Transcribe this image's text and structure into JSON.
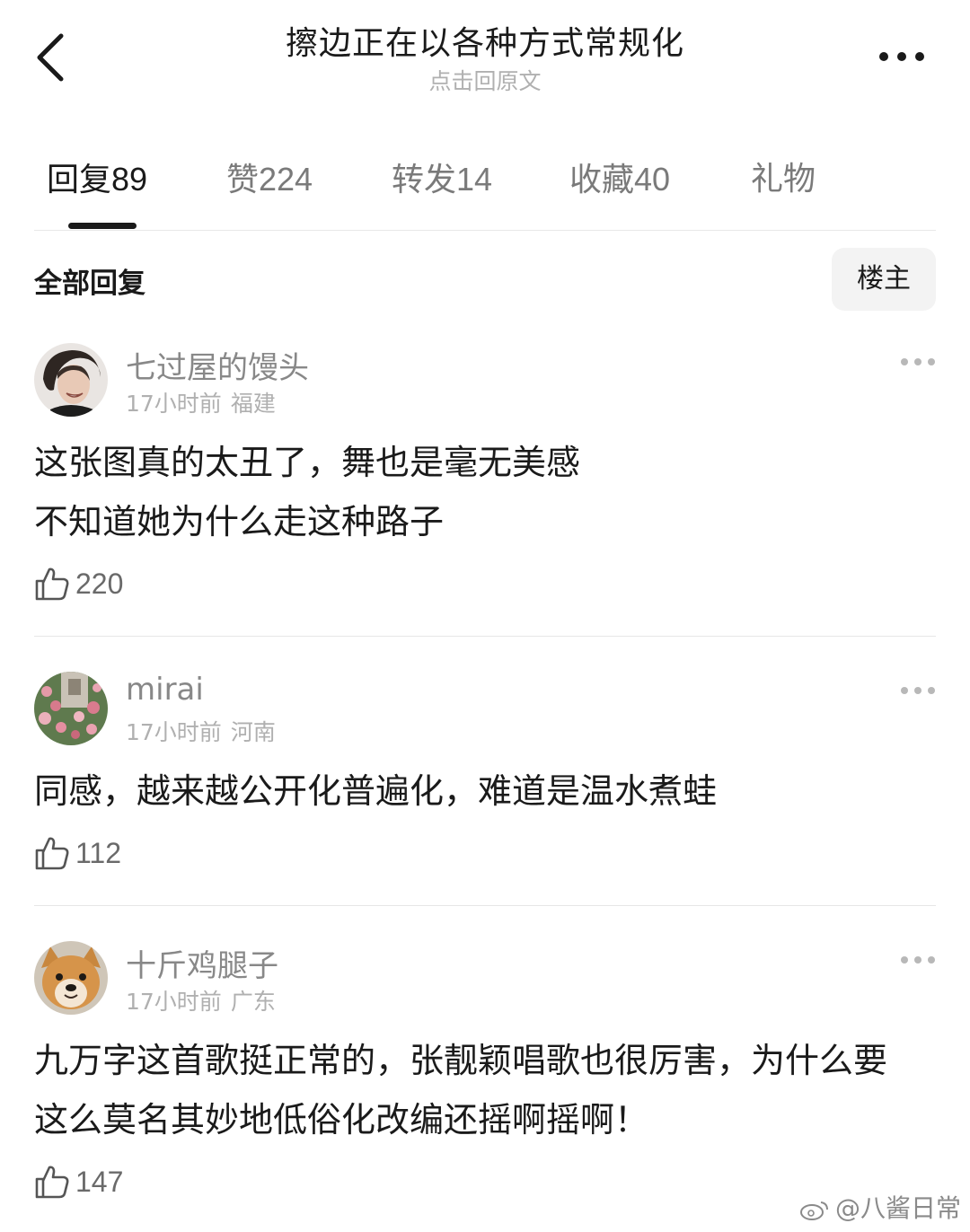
{
  "header": {
    "back_icon": "chevron-left-icon",
    "title": "擦边正在以各种方式常规化",
    "subtitle": "点击回原文",
    "more_icon": "more-horizontal-icon"
  },
  "tabs": [
    {
      "label": "回复",
      "count": "89",
      "active": true
    },
    {
      "label": "赞",
      "count": "224",
      "active": false
    },
    {
      "label": "转发",
      "count": "14",
      "active": false
    },
    {
      "label": "收藏",
      "count": "40",
      "active": false
    },
    {
      "label": "礼物",
      "count": "",
      "active": false
    }
  ],
  "filter": {
    "label": "全部回复",
    "op_button": "楼主"
  },
  "comments": [
    {
      "username": "七过屋的馒头",
      "time": "17小时前",
      "location": "福建",
      "lines": [
        "这张图真的太丑了，舞也是毫无美感",
        "不知道她为什么走这种路子"
      ],
      "likes": "220"
    },
    {
      "username": "mirai",
      "time": "17小时前",
      "location": "河南",
      "lines": [
        "同感，越来越公开化普遍化，难道是温水煮蛙"
      ],
      "likes": "112"
    },
    {
      "username": "十斤鸡腿子",
      "time": "17小时前",
      "location": "广东",
      "lines": [
        "九万字这首歌挺正常的，张靓颖唱歌也很厉害，为什么要",
        "这么莫名其妙地低俗化改编还摇啊摇啊！"
      ],
      "likes": "147"
    }
  ],
  "watermark": "@八酱日常",
  "colors": {
    "text_primary": "#1a1a1a",
    "text_secondary": "#888888",
    "text_muted": "#b0b0b0",
    "tab_inactive": "#7a7a7a",
    "button_bg": "#f3f3f3",
    "divider": "#e6e6e6"
  }
}
